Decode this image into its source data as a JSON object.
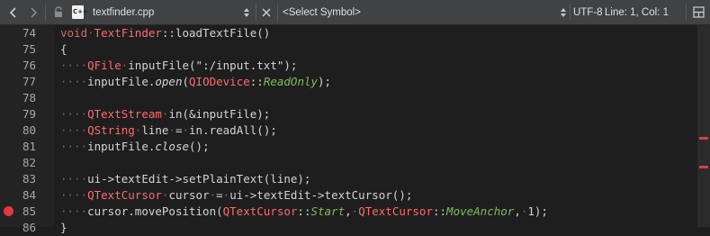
{
  "toolbar": {
    "file_icon_label": "C++",
    "file_name": "textfinder.cpp",
    "symbol_placeholder": "<Select Symbol>",
    "encoding": "UTF-8",
    "cursor_position": "Line: 1, Col: 1"
  },
  "icons": [
    "back-arrow-icon",
    "forward-arrow-icon",
    "lock-icon",
    "cpp-file-icon",
    "updown-icon",
    "close-icon",
    "updown-icon",
    "split-icon"
  ],
  "colors": {
    "breakpoint": "#e0393e",
    "keyword": "#d36b6b",
    "type": "#ff6b6b",
    "enum": "#7fbf5a"
  },
  "editor": {
    "breakpoint_line": "85",
    "lines": [
      {
        "num": "74",
        "tokens": [
          [
            "kw",
            "void"
          ],
          [
            "ws",
            "·"
          ],
          [
            "ty",
            "TextFinder"
          ],
          [
            "st",
            "::loadTextFile()"
          ]
        ]
      },
      {
        "num": "75",
        "tokens": [
          [
            "st",
            "{"
          ]
        ]
      },
      {
        "num": "76",
        "tokens": [
          [
            "ws",
            "····"
          ],
          [
            "ty",
            "QFile"
          ],
          [
            "ws",
            "·"
          ],
          [
            "st",
            "inputFile(\":/input.txt\");"
          ]
        ]
      },
      {
        "num": "77",
        "tokens": [
          [
            "ws",
            "····"
          ],
          [
            "st",
            "inputFile."
          ],
          [
            "it",
            "open"
          ],
          [
            "st",
            "("
          ],
          [
            "ty",
            "QIODevice"
          ],
          [
            "st",
            "::"
          ],
          [
            "em",
            "ReadOnly"
          ],
          [
            "st",
            ");"
          ]
        ]
      },
      {
        "num": "78",
        "tokens": []
      },
      {
        "num": "79",
        "tokens": [
          [
            "ws",
            "····"
          ],
          [
            "ty",
            "QTextStream"
          ],
          [
            "ws",
            "·"
          ],
          [
            "st",
            "in(&inputFile);"
          ]
        ]
      },
      {
        "num": "80",
        "tokens": [
          [
            "ws",
            "····"
          ],
          [
            "ty",
            "QString"
          ],
          [
            "ws",
            "·"
          ],
          [
            "st",
            "line"
          ],
          [
            "ws",
            "·"
          ],
          [
            "st",
            "="
          ],
          [
            "ws",
            "·"
          ],
          [
            "st",
            "in.readAll();"
          ]
        ]
      },
      {
        "num": "81",
        "tokens": [
          [
            "ws",
            "····"
          ],
          [
            "st",
            "inputFile."
          ],
          [
            "it",
            "close"
          ],
          [
            "st",
            "();"
          ]
        ]
      },
      {
        "num": "82",
        "tokens": []
      },
      {
        "num": "83",
        "tokens": [
          [
            "ws",
            "····"
          ],
          [
            "st",
            "ui->textEdit->setPlainText(line);"
          ]
        ]
      },
      {
        "num": "84",
        "tokens": [
          [
            "ws",
            "····"
          ],
          [
            "ty",
            "QTextCursor"
          ],
          [
            "ws",
            "·"
          ],
          [
            "st",
            "cursor"
          ],
          [
            "ws",
            "·"
          ],
          [
            "st",
            "="
          ],
          [
            "ws",
            "·"
          ],
          [
            "st",
            "ui->textEdit->textCursor();"
          ]
        ]
      },
      {
        "num": "85",
        "tokens": [
          [
            "ws",
            "····"
          ],
          [
            "st",
            "cursor.movePosition("
          ],
          [
            "ty",
            "QTextCursor"
          ],
          [
            "st",
            "::"
          ],
          [
            "em",
            "Start"
          ],
          [
            "st",
            ","
          ],
          [
            "ws",
            "·"
          ],
          [
            "ty",
            "QTextCursor"
          ],
          [
            "st",
            "::"
          ],
          [
            "em",
            "MoveAnchor"
          ],
          [
            "st",
            ","
          ],
          [
            "ws",
            "·"
          ],
          [
            "st",
            "1);"
          ]
        ]
      },
      {
        "num": "86",
        "tokens": [
          [
            "st",
            "}"
          ]
        ]
      }
    ]
  }
}
